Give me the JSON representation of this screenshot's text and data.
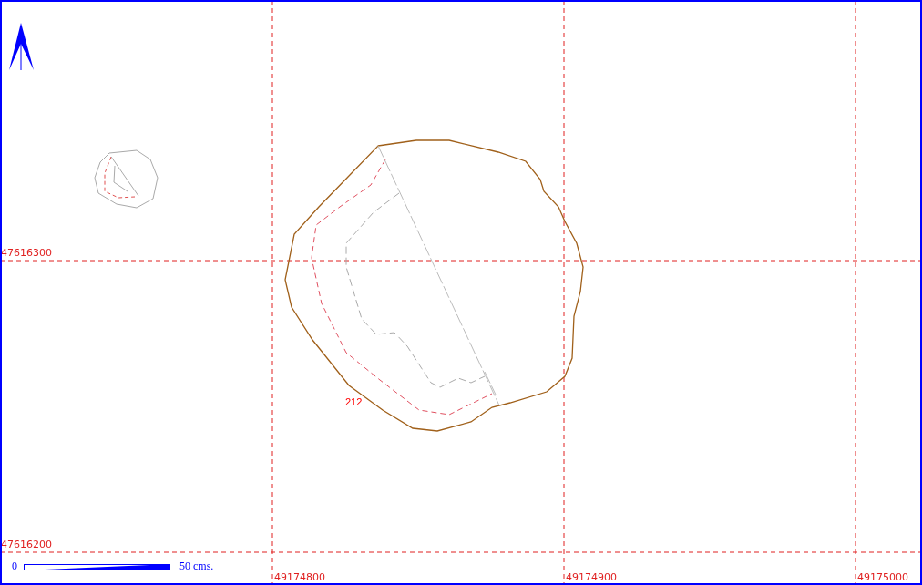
{
  "grid": {
    "y_lines": [
      {
        "label": "47616300"
      },
      {
        "label": "47616200"
      }
    ],
    "x_lines": [
      {
        "label": "49174800"
      },
      {
        "label": "49174900"
      },
      {
        "label": "49175000"
      }
    ]
  },
  "parcels": [
    {
      "label": "212"
    }
  ],
  "scale_bar": {
    "start_label": "0",
    "end_label": "50 cms."
  }
}
